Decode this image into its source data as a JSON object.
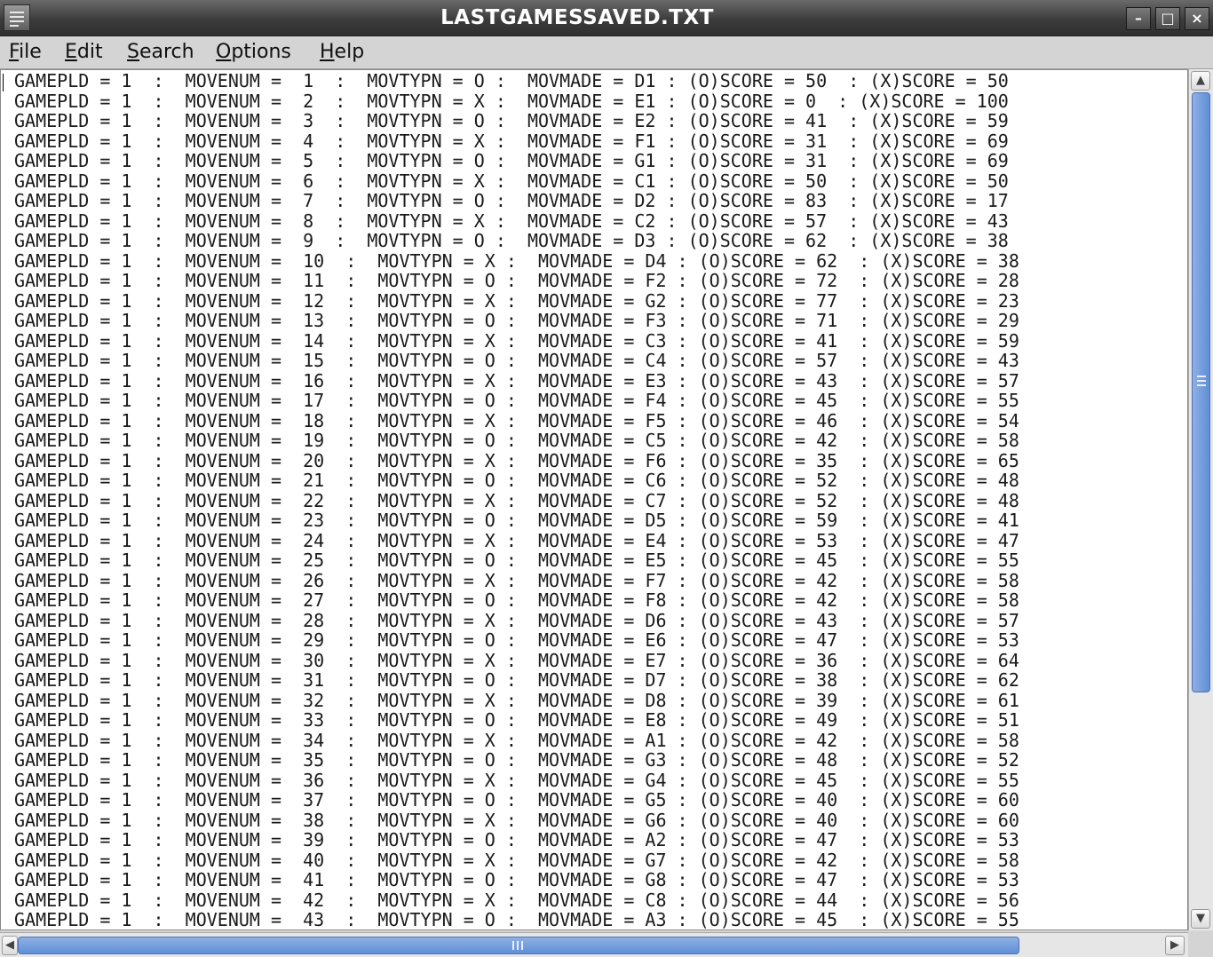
{
  "window": {
    "title": "LASTGAMESSAVED.TXT",
    "minimize_symbol": "–",
    "maximize_symbol": "□",
    "close_symbol": "×"
  },
  "menu": [
    {
      "accel": "F",
      "rest": "ile"
    },
    {
      "accel": "E",
      "rest": "dit"
    },
    {
      "accel": "S",
      "rest": "earch"
    },
    {
      "accel": "O",
      "rest": "ptions"
    },
    {
      "accel": "H",
      "rest": "elp"
    }
  ],
  "colors": {
    "titlebar": "#3c3c3c",
    "menubar": "#d4d4d4",
    "editor_bg": "#ffffff",
    "scroll_thumb": "#5f8fd8"
  },
  "lines": [
    "GAMEPLD = 1  :  MOVENUM =  1  :  MOVTYPN = O :  MOVMADE = D1 : (O)SCORE = 50  : (X)SCORE = 50",
    "GAMEPLD = 1  :  MOVENUM =  2  :  MOVTYPN = X :  MOVMADE = E1 : (O)SCORE = 0  : (X)SCORE = 100",
    "GAMEPLD = 1  :  MOVENUM =  3  :  MOVTYPN = O :  MOVMADE = E2 : (O)SCORE = 41  : (X)SCORE = 59",
    "GAMEPLD = 1  :  MOVENUM =  4  :  MOVTYPN = X :  MOVMADE = F1 : (O)SCORE = 31  : (X)SCORE = 69",
    "GAMEPLD = 1  :  MOVENUM =  5  :  MOVTYPN = O :  MOVMADE = G1 : (O)SCORE = 31  : (X)SCORE = 69",
    "GAMEPLD = 1  :  MOVENUM =  6  :  MOVTYPN = X :  MOVMADE = C1 : (O)SCORE = 50  : (X)SCORE = 50",
    "GAMEPLD = 1  :  MOVENUM =  7  :  MOVTYPN = O :  MOVMADE = D2 : (O)SCORE = 83  : (X)SCORE = 17",
    "GAMEPLD = 1  :  MOVENUM =  8  :  MOVTYPN = X :  MOVMADE = C2 : (O)SCORE = 57  : (X)SCORE = 43",
    "GAMEPLD = 1  :  MOVENUM =  9  :  MOVTYPN = O :  MOVMADE = D3 : (O)SCORE = 62  : (X)SCORE = 38",
    "GAMEPLD = 1  :  MOVENUM =  10  :  MOVTYPN = X :  MOVMADE = D4 : (O)SCORE = 62  : (X)SCORE = 38",
    "GAMEPLD = 1  :  MOVENUM =  11  :  MOVTYPN = O :  MOVMADE = F2 : (O)SCORE = 72  : (X)SCORE = 28",
    "GAMEPLD = 1  :  MOVENUM =  12  :  MOVTYPN = X :  MOVMADE = G2 : (O)SCORE = 77  : (X)SCORE = 23",
    "GAMEPLD = 1  :  MOVENUM =  13  :  MOVTYPN = O :  MOVMADE = F3 : (O)SCORE = 71  : (X)SCORE = 29",
    "GAMEPLD = 1  :  MOVENUM =  14  :  MOVTYPN = X :  MOVMADE = C3 : (O)SCORE = 41  : (X)SCORE = 59",
    "GAMEPLD = 1  :  MOVENUM =  15  :  MOVTYPN = O :  MOVMADE = C4 : (O)SCORE = 57  : (X)SCORE = 43",
    "GAMEPLD = 1  :  MOVENUM =  16  :  MOVTYPN = X :  MOVMADE = E3 : (O)SCORE = 43  : (X)SCORE = 57",
    "GAMEPLD = 1  :  MOVENUM =  17  :  MOVTYPN = O :  MOVMADE = F4 : (O)SCORE = 45  : (X)SCORE = 55",
    "GAMEPLD = 1  :  MOVENUM =  18  :  MOVTYPN = X :  MOVMADE = F5 : (O)SCORE = 46  : (X)SCORE = 54",
    "GAMEPLD = 1  :  MOVENUM =  19  :  MOVTYPN = O :  MOVMADE = C5 : (O)SCORE = 42  : (X)SCORE = 58",
    "GAMEPLD = 1  :  MOVENUM =  20  :  MOVTYPN = X :  MOVMADE = F6 : (O)SCORE = 35  : (X)SCORE = 65",
    "GAMEPLD = 1  :  MOVENUM =  21  :  MOVTYPN = O :  MOVMADE = C6 : (O)SCORE = 52  : (X)SCORE = 48",
    "GAMEPLD = 1  :  MOVENUM =  22  :  MOVTYPN = X :  MOVMADE = C7 : (O)SCORE = 52  : (X)SCORE = 48",
    "GAMEPLD = 1  :  MOVENUM =  23  :  MOVTYPN = O :  MOVMADE = D5 : (O)SCORE = 59  : (X)SCORE = 41",
    "GAMEPLD = 1  :  MOVENUM =  24  :  MOVTYPN = X :  MOVMADE = E4 : (O)SCORE = 53  : (X)SCORE = 47",
    "GAMEPLD = 1  :  MOVENUM =  25  :  MOVTYPN = O :  MOVMADE = E5 : (O)SCORE = 45  : (X)SCORE = 55",
    "GAMEPLD = 1  :  MOVENUM =  26  :  MOVTYPN = X :  MOVMADE = F7 : (O)SCORE = 42  : (X)SCORE = 58",
    "GAMEPLD = 1  :  MOVENUM =  27  :  MOVTYPN = O :  MOVMADE = F8 : (O)SCORE = 42  : (X)SCORE = 58",
    "GAMEPLD = 1  :  MOVENUM =  28  :  MOVTYPN = X :  MOVMADE = D6 : (O)SCORE = 43  : (X)SCORE = 57",
    "GAMEPLD = 1  :  MOVENUM =  29  :  MOVTYPN = O :  MOVMADE = E6 : (O)SCORE = 47  : (X)SCORE = 53",
    "GAMEPLD = 1  :  MOVENUM =  30  :  MOVTYPN = X :  MOVMADE = E7 : (O)SCORE = 36  : (X)SCORE = 64",
    "GAMEPLD = 1  :  MOVENUM =  31  :  MOVTYPN = O :  MOVMADE = D7 : (O)SCORE = 38  : (X)SCORE = 62",
    "GAMEPLD = 1  :  MOVENUM =  32  :  MOVTYPN = X :  MOVMADE = D8 : (O)SCORE = 39  : (X)SCORE = 61",
    "GAMEPLD = 1  :  MOVENUM =  33  :  MOVTYPN = O :  MOVMADE = E8 : (O)SCORE = 49  : (X)SCORE = 51",
    "GAMEPLD = 1  :  MOVENUM =  34  :  MOVTYPN = X :  MOVMADE = A1 : (O)SCORE = 42  : (X)SCORE = 58",
    "GAMEPLD = 1  :  MOVENUM =  35  :  MOVTYPN = O :  MOVMADE = G3 : (O)SCORE = 48  : (X)SCORE = 52",
    "GAMEPLD = 1  :  MOVENUM =  36  :  MOVTYPN = X :  MOVMADE = G4 : (O)SCORE = 45  : (X)SCORE = 55",
    "GAMEPLD = 1  :  MOVENUM =  37  :  MOVTYPN = O :  MOVMADE = G5 : (O)SCORE = 40  : (X)SCORE = 60",
    "GAMEPLD = 1  :  MOVENUM =  38  :  MOVTYPN = X :  MOVMADE = G6 : (O)SCORE = 40  : (X)SCORE = 60",
    "GAMEPLD = 1  :  MOVENUM =  39  :  MOVTYPN = O :  MOVMADE = A2 : (O)SCORE = 47  : (X)SCORE = 53",
    "GAMEPLD = 1  :  MOVENUM =  40  :  MOVTYPN = X :  MOVMADE = G7 : (O)SCORE = 42  : (X)SCORE = 58",
    "GAMEPLD = 1  :  MOVENUM =  41  :  MOVTYPN = O :  MOVMADE = G8 : (O)SCORE = 47  : (X)SCORE = 53",
    "GAMEPLD = 1  :  MOVENUM =  42  :  MOVTYPN = X :  MOVMADE = C8 : (O)SCORE = 44  : (X)SCORE = 56",
    "GAMEPLD = 1  :  MOVENUM =  43  :  MOVTYPN = O :  MOVMADE = A3 : (O)SCORE = 45  : (X)SCORE = 55"
  ]
}
